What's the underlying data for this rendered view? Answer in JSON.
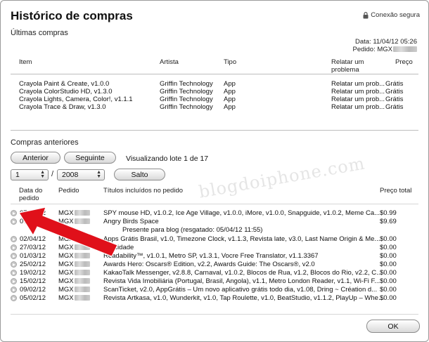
{
  "window": {
    "title": "Histórico de compras",
    "secure_label": "Conexão segura"
  },
  "recent": {
    "heading": "Últimas compras",
    "date_label": "Data:",
    "date_value": "11/04/12 05:26",
    "order_label": "Pedido:",
    "order_value": "MGX",
    "headers": {
      "item": "Item",
      "artist": "Artista",
      "type": "Tipo",
      "report": "Relatar um problema",
      "price": "Preço"
    },
    "rows": [
      {
        "item": "Crayola Paint & Create, v1.0.0",
        "artist": "Griffin Technology",
        "type": "App",
        "report": "Relatar um prob...",
        "price": "Grátis"
      },
      {
        "item": "Crayola ColorStudio HD, v1.3.0",
        "artist": "Griffin Technology",
        "type": "App",
        "report": "Relatar um prob...",
        "price": "Grátis"
      },
      {
        "item": "Crayola Lights, Camera, Color!, v1.1.1",
        "artist": "Griffin Technology",
        "type": "App",
        "report": "Relatar um prob...",
        "price": "Grátis"
      },
      {
        "item": "Crayola Trace & Draw, v1.3.0",
        "artist": "Griffin Technology",
        "type": "App",
        "report": "Relatar um prob...",
        "price": "Grátis"
      }
    ]
  },
  "previous": {
    "heading": "Compras anteriores",
    "prev_button": "Anterior",
    "next_button": "Seguinte",
    "batch_text": "Visualizando lote 1 de 17",
    "month_value": "1",
    "year_value": "2008",
    "separator": "/",
    "jump_button": "Salto",
    "headers": {
      "date": "Data do pedido",
      "order": "Pedido",
      "titles": "Títulos incluídos no pedido",
      "total": "Preço total"
    },
    "rows": [
      {
        "date": "07/04/12",
        "order": "MGX",
        "titles": "SPY mouse HD, v1.0.2, Ice Age Village, v1.0.0, iMore, v1.0.0, Snapguide, v1.0.2, Meme Ca...",
        "total": "$0.99"
      },
      {
        "date": "07/04/12",
        "order": "MGX",
        "titles": "Angry Birds Space",
        "total": "$9.69"
      },
      {
        "date": "02/04/12",
        "order": "MGX",
        "titles": "Apps Grátis Brasil, v1.0, Timezone Clock, v1.1.3, Revista late, v3.0, Last Name Origin & Me...",
        "total": "$0.00"
      },
      {
        "date": "27/03/12",
        "order": "MGX",
        "titles": "Felicidade",
        "total": "$0.00"
      },
      {
        "date": "01/03/12",
        "order": "MGX",
        "titles": "Readability™, v1.0.1, Metro SP, v1.3.1, Vocre Free Translator, v1.1.3367",
        "total": "$0.00"
      },
      {
        "date": "25/02/12",
        "order": "MGX",
        "titles": "Awards Hero: Oscars® Edition, v2.2, Awards Guide: The Oscars®, v2.0",
        "total": "$0.00"
      },
      {
        "date": "19/02/12",
        "order": "MGX",
        "titles": "KakaoTalk Messenger, v2.8.8, Carnaval, v1.0.2, Blocos de Rua, v1.2, Blocos do Rio, v2.2, C...",
        "total": "$0.00"
      },
      {
        "date": "15/02/12",
        "order": "MGX",
        "titles": "Revista Vida Imobiliária (Portugal, Brasil, Angola), v1.1, Metro London Reader, v1.1, Wi-Fi F...",
        "total": "$0.00"
      },
      {
        "date": "09/02/12",
        "order": "MGX",
        "titles": "ScanTicket, v2.0, AppGrátis – Um novo aplicativo grátis todo dia, v1.08, Dring ~ Création d...",
        "total": "$0.00"
      },
      {
        "date": "05/02/12",
        "order": "MGX",
        "titles": "Revista Artkasa, v1.0, Wunderkit, v1.0, Tap Roulette, v1.0, BeatStudio, v1.1.2, PlayUp – Whe...",
        "total": "$0.00"
      }
    ],
    "gift_note": "Presente para blog (resgatado: 05/04/12 11:55)"
  },
  "watermark": "blogdoiphone.com",
  "ok_button": "OK",
  "colors": {
    "annotation_arrow": "#e0101a"
  }
}
